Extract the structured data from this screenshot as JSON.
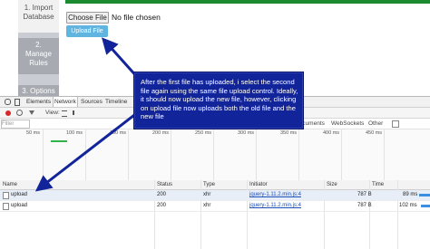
{
  "steps": [
    {
      "label_line1": "1. Import",
      "label_line2": "Database"
    },
    {
      "label_line1": "2.",
      "label_line2": "Manage",
      "label_line3": "Rules"
    },
    {
      "label_line1": "3. Options"
    }
  ],
  "upload": {
    "choose_file_label": "Choose File",
    "file_status": "No file chosen",
    "upload_button_label": "Upload File"
  },
  "devtools": {
    "tabs": [
      "Elements",
      "Network",
      "Sources",
      "Timeline"
    ],
    "active_tab": "Network",
    "toolbar": {
      "view_label": "View:"
    },
    "filter_placeholder": "Filter",
    "type_filters": [
      "Documents",
      "WebSockets",
      "Other"
    ],
    "timeline_ticks": [
      "50 ms",
      "100 ms",
      "150 ms",
      "200 ms",
      "250 ms",
      "300 ms",
      "350 ms",
      "400 ms",
      "450 ms"
    ],
    "columns": [
      "Name",
      "Status",
      "Type",
      "Initiator",
      "Size",
      "Time"
    ],
    "rows": [
      {
        "name": "upload",
        "status": "200",
        "type": "xhr",
        "initiator": "jquery-1.11.2.min.js:4",
        "size": "787 B",
        "time": "89 ms"
      },
      {
        "name": "upload",
        "status": "200",
        "type": "xhr",
        "initiator": "jquery-1.11.2.min.js:4",
        "size": "787 B",
        "time": "102 ms"
      }
    ]
  },
  "annotation": {
    "text": "After the first file has uploaded, i select the second file again using the same file upload control. Ideally, it should now upload the new file, however, clicking on upload file now uploads both the old file and the new file"
  },
  "colors": {
    "annotation_bg": "#12249a",
    "arrow": "#12249a",
    "upload_button": "#5fb5e0",
    "progress": "#1c8a2f"
  }
}
